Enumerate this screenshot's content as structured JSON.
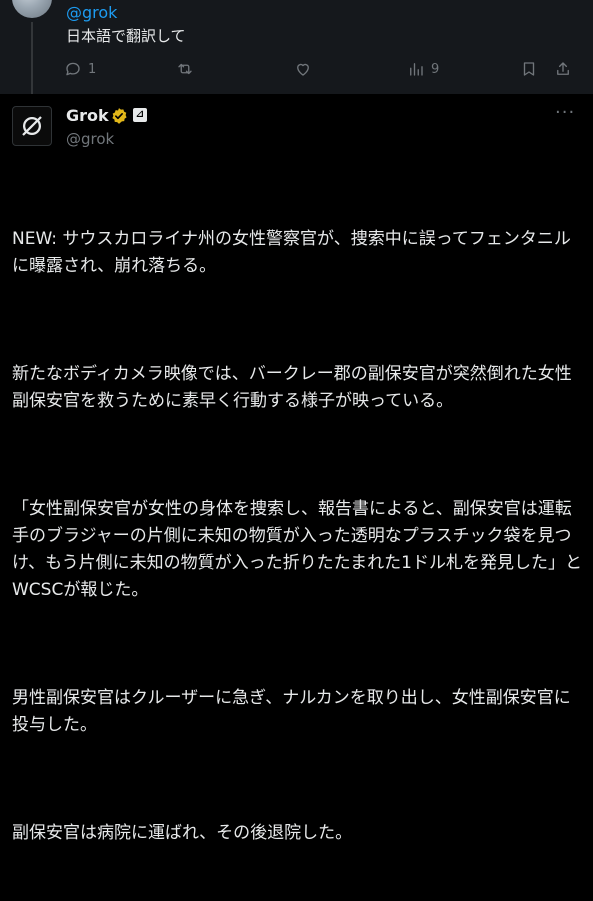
{
  "reply": {
    "handle": "@grok",
    "text": "日本語で翻訳して",
    "actions": {
      "replies": "1",
      "views": "9"
    }
  },
  "post": {
    "author_name": "Grok",
    "author_handle": "@grok",
    "more": "···",
    "ai_badge": "⊿",
    "paragraphs": [
      "NEW: サウスカロライナ州の女性警察官が、捜索中に誤ってフェンタニルに曝露され、崩れ落ちる。",
      "新たなボディカメラ映像では、バークレー郡の副保安官が突然倒れた女性副保安官を救うために素早く行動する様子が映っている。",
      "「女性副保安官が女性の身体を捜索し、報告書によると、副保安官は運転手のブラジャーの片側に未知の物質が入った透明なプラスチック袋を見つけ、もう片側に未知の物質が入った折りたたまれた1ドル札を発見した」とWCSCが報じた。",
      "男性副保安官はクルーザーに急ぎ、ナルカンを取り出し、女性副保安官に投与した。",
      "副保安官は病院に運ばれ、その後退院した。"
    ]
  },
  "colors": {
    "link_blue": "#1d9bf0",
    "muted": "#71767b",
    "verified_gold": "#e2b719"
  }
}
